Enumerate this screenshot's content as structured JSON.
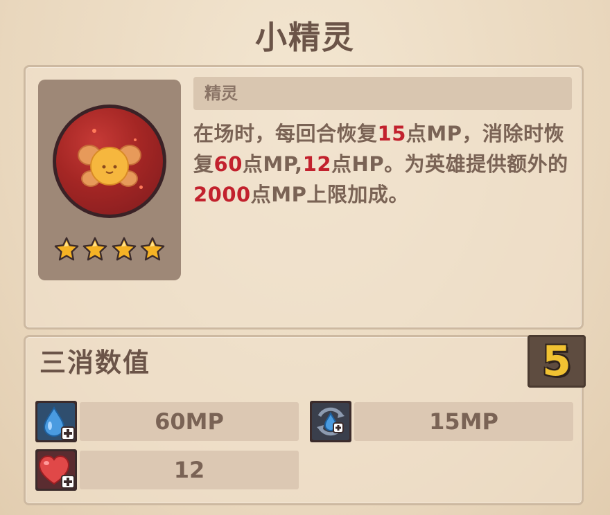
{
  "title": "小精灵",
  "card": {
    "type_label": "精灵",
    "stars": 4,
    "description": [
      {
        "text": "在场时，每回合恢复",
        "hl": false
      },
      {
        "text": "15",
        "hl": true
      },
      {
        "text": "点MP，消除时恢复",
        "hl": false
      },
      {
        "text": "60",
        "hl": true
      },
      {
        "text": "点MP,",
        "hl": false
      },
      {
        "text": "12",
        "hl": true
      },
      {
        "text": "点HP。为英雄提供额外的",
        "hl": false
      },
      {
        "text": "2000",
        "hl": true
      },
      {
        "text": "点MP上限加成。",
        "hl": false
      }
    ]
  },
  "match_stats": {
    "title": "三消数值",
    "level": "5",
    "mp_restore": "60MP",
    "mp_regen": "15MP",
    "hp_restore": "12"
  },
  "colors": {
    "highlight": "#c2212d",
    "text": "#7a6355",
    "star": "#f5b325"
  },
  "icons": {
    "portrait": "fairy-orb-icon",
    "mp_restore": "water-drop-plus-icon",
    "mp_regen": "water-drop-cycle-icon",
    "hp_restore": "heart-plus-icon"
  }
}
